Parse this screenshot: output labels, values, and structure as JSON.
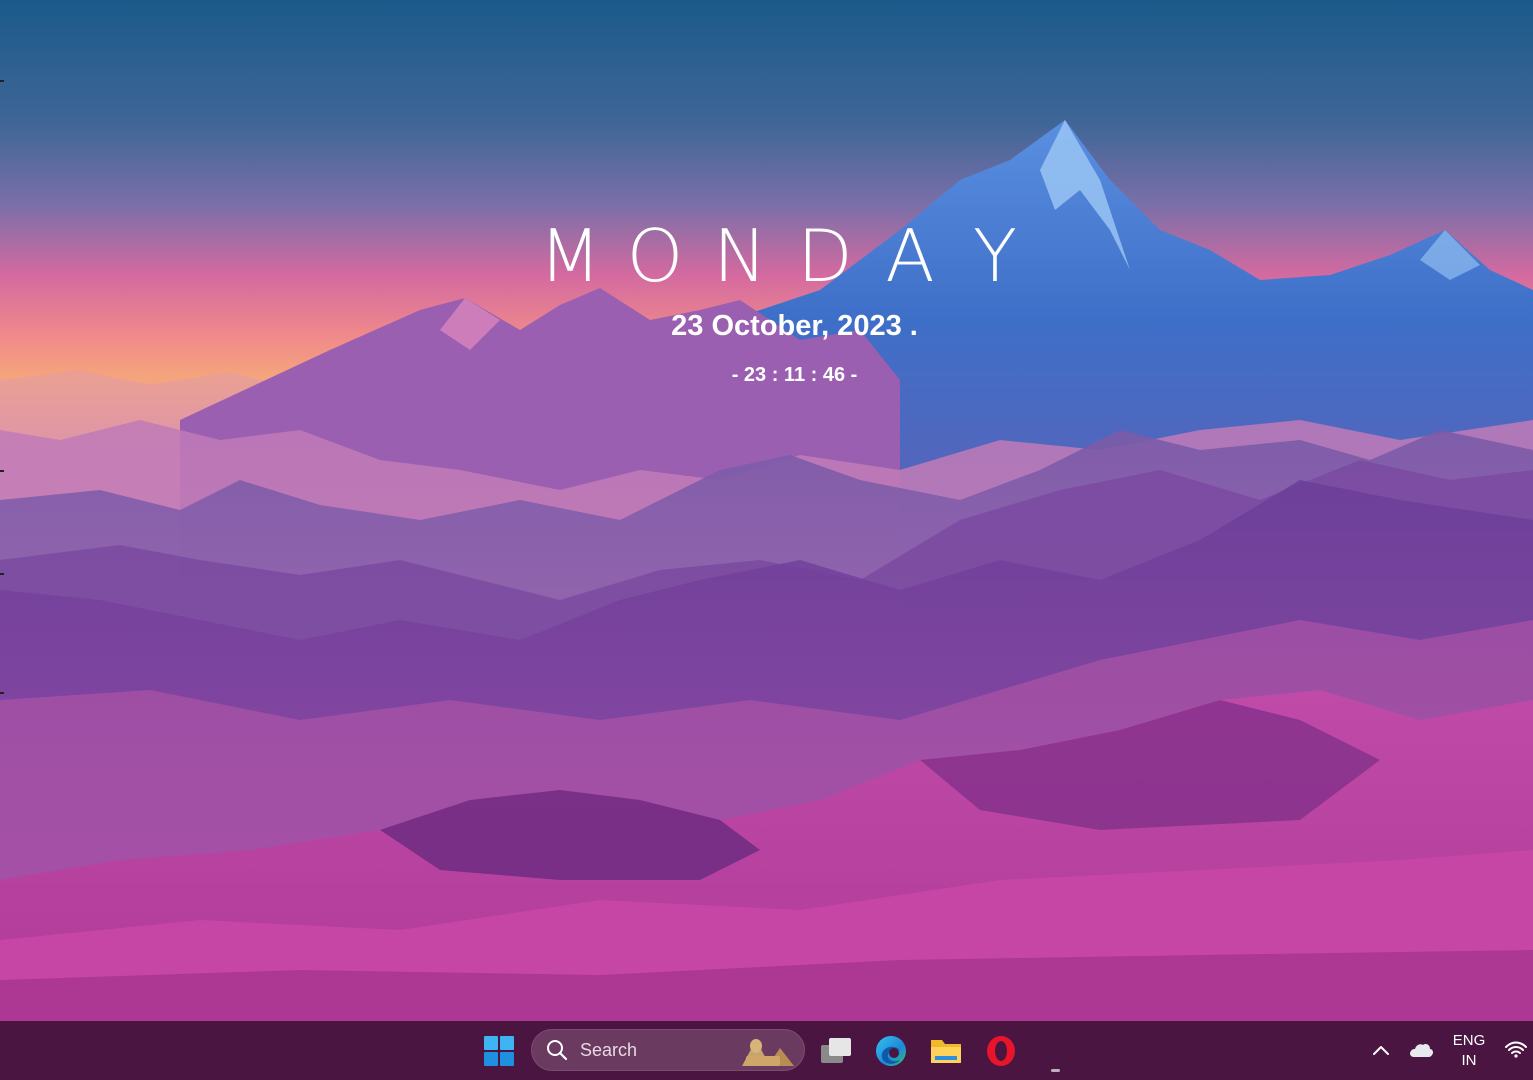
{
  "widget": {
    "day_letters": [
      "M",
      "O",
      "N",
      "D",
      "A",
      "Y"
    ],
    "date": "23 October, 2023 .",
    "time": "- 23 : 11 : 46 -"
  },
  "taskbar": {
    "search_placeholder": "Search",
    "pinned_apps": [
      "start-icon",
      "task-view-icon",
      "edge-icon",
      "file-explorer-icon",
      "opera-icon"
    ],
    "tray": {
      "language_line1": "ENG",
      "language_line2": "IN",
      "icons": [
        "chevron-up-icon",
        "onedrive-cloud-icon",
        "wifi-icon"
      ]
    },
    "colors": {
      "bar": "#4a1641",
      "search": "#6b3a60"
    }
  }
}
